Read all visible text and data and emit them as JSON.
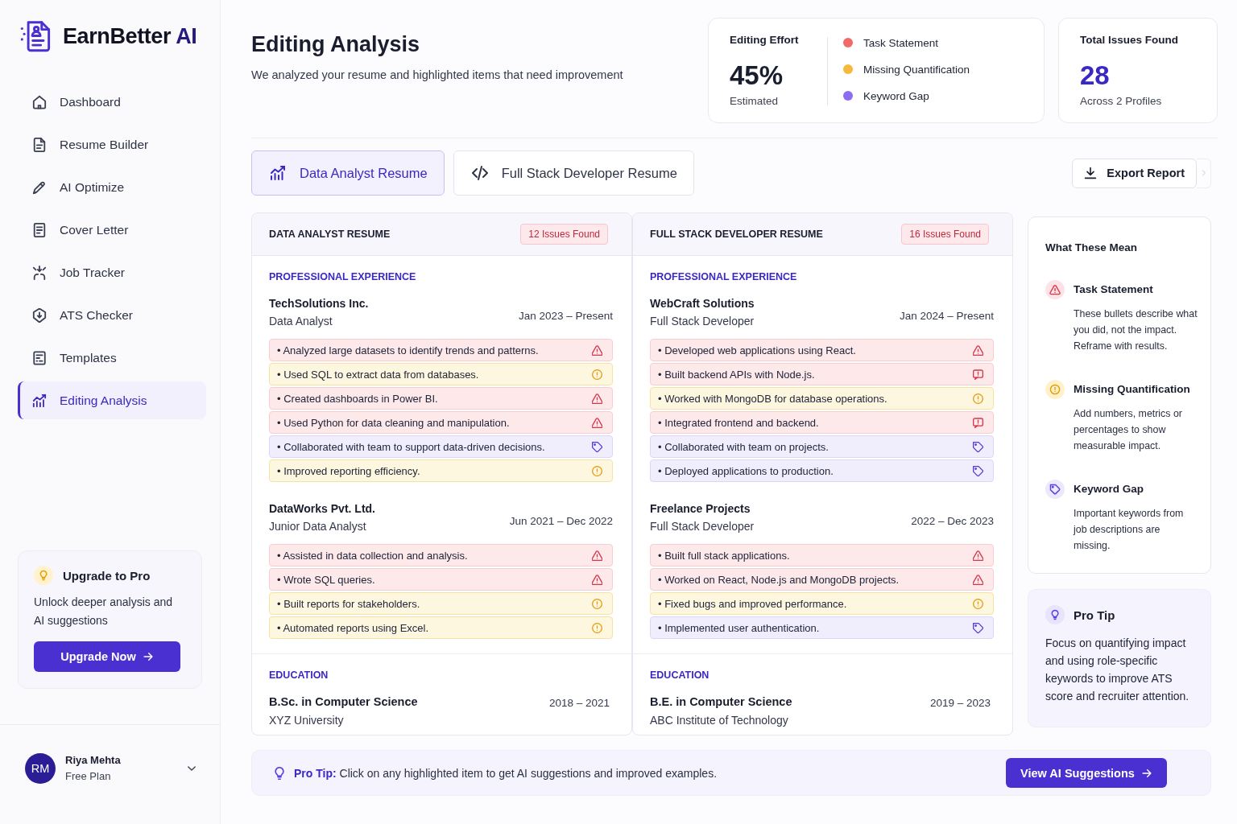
{
  "sidebar": {
    "brand": {
      "name": "EarnBetter",
      "accent": "AI"
    },
    "nav": [
      {
        "label": "Dashboard",
        "selected": false
      },
      {
        "label": "Resume Builder",
        "selected": false
      },
      {
        "label": "AI Optimize",
        "selected": false
      },
      {
        "label": "Cover Letter",
        "selected": false
      },
      {
        "label": "Job Tracker",
        "selected": false
      },
      {
        "label": "ATS Checker",
        "selected": false
      },
      {
        "label": "Templates",
        "selected": false
      },
      {
        "label": "Editing Analysis",
        "selected": true
      }
    ],
    "upgrade": {
      "title": "Upgrade to Pro",
      "text": "Unlock deeper analysis and AI suggestions",
      "button": "Upgrade Now"
    },
    "user": {
      "initials": "RM",
      "name": "Riya Mehta",
      "plan": "Free Plan"
    }
  },
  "header": {
    "title": "Editing Analysis",
    "subtitle": "We analyzed your resume and highlighted items that need improvement"
  },
  "editing_effort": {
    "label": "Editing Effort",
    "value": "45%",
    "note": "Estimated",
    "legend": [
      {
        "label": "Task Statement",
        "color": "#f06a6a"
      },
      {
        "label": "Missing Quantification",
        "color": "#f6b93b"
      },
      {
        "label": "Keyword Gap",
        "color": "#8c6cf0"
      }
    ]
  },
  "total_issues": {
    "label": "Total Issues Found",
    "value": "28",
    "note": "Across 2 Profiles"
  },
  "tabs": [
    {
      "label": "Data Analyst Resume",
      "selected": true
    },
    {
      "label": "Full Stack Developer Resume",
      "selected": false
    }
  ],
  "export_button": "Export Report",
  "resumes": [
    {
      "title": "DATA ANALYST RESUME",
      "badge": "12 Issues Found",
      "experience_heading": "PROFESSIONAL EXPERIENCE",
      "jobs": [
        {
          "company": "TechSolutions Inc.",
          "role": "Data Analyst",
          "dates": "Jan 2023 – Present",
          "bullets": [
            {
              "text": "• Analyzed large datasets to identify trends and patterns.",
              "kind": "task"
            },
            {
              "text": "• Used SQL to extract data from databases.",
              "kind": "quantification"
            },
            {
              "text": "• Created dashboards in Power BI.",
              "kind": "task"
            },
            {
              "text": "• Used Python for data cleaning and manipulation.",
              "kind": "task"
            },
            {
              "text": "• Collaborated with team to support data-driven decisions.",
              "kind": "keyword"
            },
            {
              "text": "• Improved reporting efficiency.",
              "kind": "quantification"
            }
          ]
        },
        {
          "company": "DataWorks Pvt. Ltd.",
          "role": "Junior Data Analyst",
          "dates": "Jun 2021 – Dec 2022",
          "bullets": [
            {
              "text": "• Assisted in data collection and analysis.",
              "kind": "task"
            },
            {
              "text": "• Wrote SQL queries.",
              "kind": "task"
            },
            {
              "text": "• Built reports for stakeholders.",
              "kind": "quantification"
            },
            {
              "text": "• Automated reports using Excel.",
              "kind": "quantification"
            }
          ]
        }
      ],
      "education_heading": "EDUCATION",
      "education": {
        "degree": "B.Sc. in Computer Science",
        "school": "XYZ University",
        "dates": "2018 – 2021"
      }
    },
    {
      "title": "FULL STACK DEVELOPER RESUME",
      "badge": "16 Issues Found",
      "experience_heading": "PROFESSIONAL EXPERIENCE",
      "jobs": [
        {
          "company": "WebCraft Solutions",
          "role": "Full Stack Developer",
          "dates": "Jan 2024 – Present",
          "bullets": [
            {
              "text": "• Developed web applications using React.",
              "kind": "task"
            },
            {
              "text": "• Built backend APIs with Node.js.",
              "kind": "alert"
            },
            {
              "text": "• Worked with MongoDB for database operations.",
              "kind": "quantification"
            },
            {
              "text": "• Integrated frontend and backend.",
              "kind": "alert"
            },
            {
              "text": "• Collaborated with team on projects.",
              "kind": "keyword"
            },
            {
              "text": "• Deployed applications to production.",
              "kind": "keyword"
            }
          ]
        },
        {
          "company": "Freelance Projects",
          "role": "Full Stack Developer",
          "dates": "2022 – Dec 2023",
          "bullets": [
            {
              "text": "• Built full stack applications.",
              "kind": "task"
            },
            {
              "text": "• Worked on React, Node.js and MongoDB projects.",
              "kind": "task"
            },
            {
              "text": "• Fixed bugs and improved performance.",
              "kind": "quantification"
            },
            {
              "text": "• Implemented user authentication.",
              "kind": "keyword"
            }
          ]
        }
      ],
      "education_heading": "EDUCATION",
      "education": {
        "degree": "B.E. in Computer Science",
        "school": "ABC Institute of Technology",
        "dates": "2019 – 2023"
      }
    }
  ],
  "legend_panel": {
    "title": "What These Mean",
    "items": [
      {
        "kind": "task",
        "title": "Task Statement",
        "text": "These bullets describe what you did, not the impact. Reframe with results."
      },
      {
        "kind": "quantification",
        "title": "Missing Quantification",
        "text": "Add numbers, metrics or percentages to show measurable impact."
      },
      {
        "kind": "keyword",
        "title": "Keyword Gap",
        "text": "Important keywords from job descriptions are missing."
      }
    ]
  },
  "pro_tip": {
    "title": "Pro Tip",
    "text": "Focus on quantifying impact and using role-specific keywords to improve ATS score and recruiter attention."
  },
  "tip_bar": {
    "text": "**Pro Tip:** Click on any highlighted item to get AI suggestions and improved examples.",
    "button": "View AI Suggestions"
  }
}
